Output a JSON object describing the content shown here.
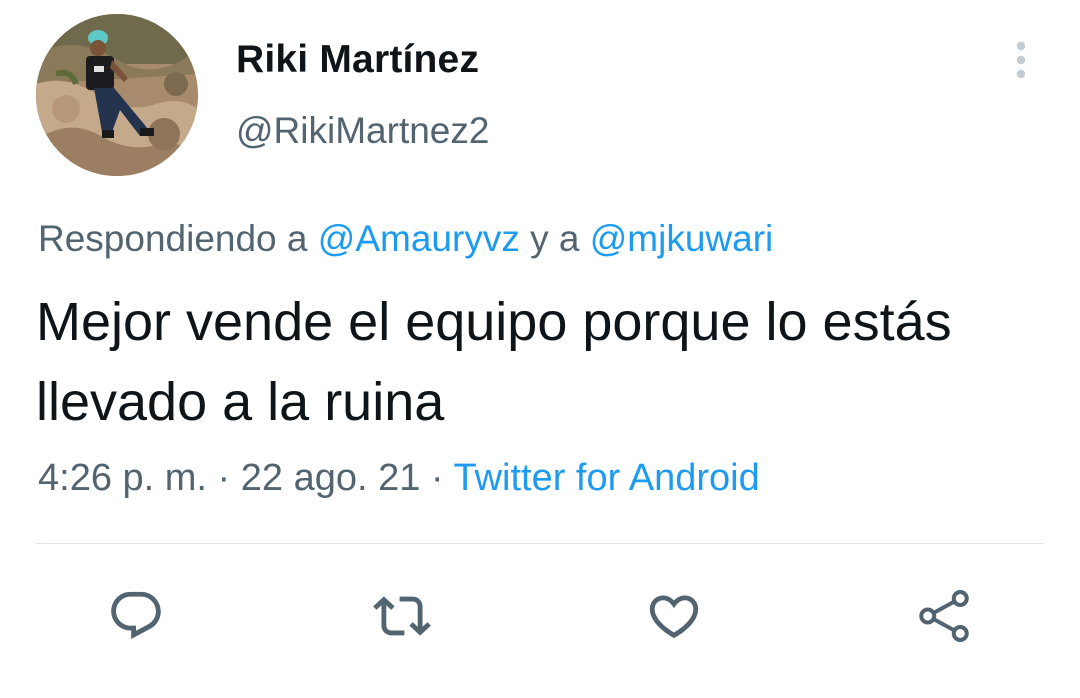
{
  "user": {
    "display_name": "Riki Martínez",
    "handle": "@RikiMartnez2"
  },
  "reply": {
    "prefix": "Respondiendo a ",
    "mention1": "@Amauryvz",
    "joiner": " y a ",
    "mention2": "@mjkuwari"
  },
  "tweet": {
    "text": "Mejor vende el equipo porque lo estás llevado a la ruina"
  },
  "meta": {
    "time": "4:26 p. m.",
    "sep1": " · ",
    "date": "22 ago. 21",
    "sep2": " · ",
    "source": "Twitter for Android"
  },
  "icons": {
    "more": "more-vertical-icon",
    "reply": "reply-icon",
    "retweet": "retweet-icon",
    "like": "heart-icon",
    "share": "share-icon"
  },
  "colors": {
    "text": "#0f1419",
    "secondary": "#536471",
    "link": "#1d9bf0",
    "icon": "#536471"
  }
}
